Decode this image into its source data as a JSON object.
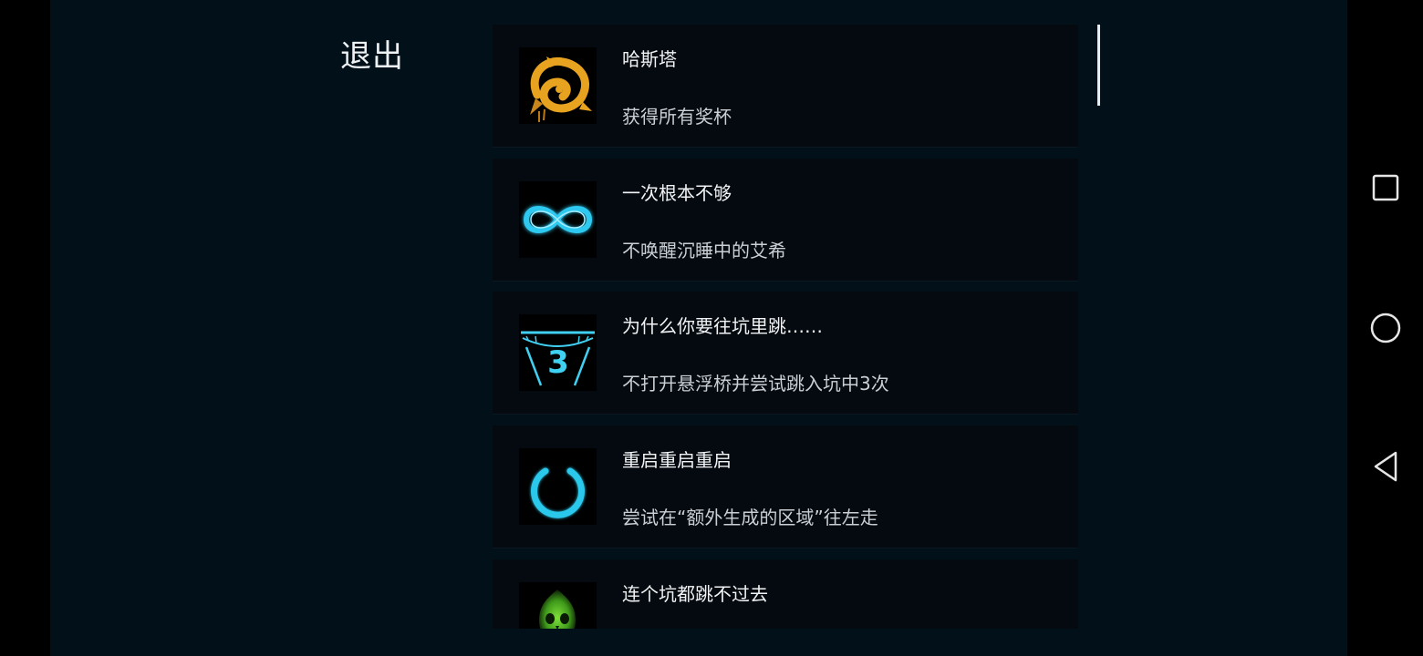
{
  "header": {
    "exit_label": "退出"
  },
  "achievements": [
    {
      "title": "哈斯塔",
      "description": "获得所有奖杯",
      "icon": "hastur-sigil-icon",
      "icon_color": "#e7a21f"
    },
    {
      "title": "一次根本不够",
      "description": "不唤醒沉睡中的艾希",
      "icon": "infinity-icon",
      "icon_color": "#2fc9f0"
    },
    {
      "title": "为什么你要往坑里跳……",
      "description": "不打开悬浮桥并尝试跳入坑中3次",
      "icon": "pit-jump-3-icon",
      "icon_color": "#3fd0f2",
      "icon_text": "3"
    },
    {
      "title": "重启重启重启",
      "description": "尝试在“额外生成的区域”往左走",
      "icon": "power-icon",
      "icon_color": "#29c8ea"
    },
    {
      "title": "连个坑都跳不过去",
      "description": "",
      "icon": "green-skull-icon",
      "icon_color": "#5fd02a"
    }
  ],
  "colors": {
    "background": "#02101a",
    "card": "#050a10",
    "text_primary": "#f1f3f5",
    "text_secondary": "#c9cfd4"
  },
  "navigation": {
    "icons": [
      "recent-apps-icon",
      "home-icon",
      "back-icon"
    ]
  }
}
